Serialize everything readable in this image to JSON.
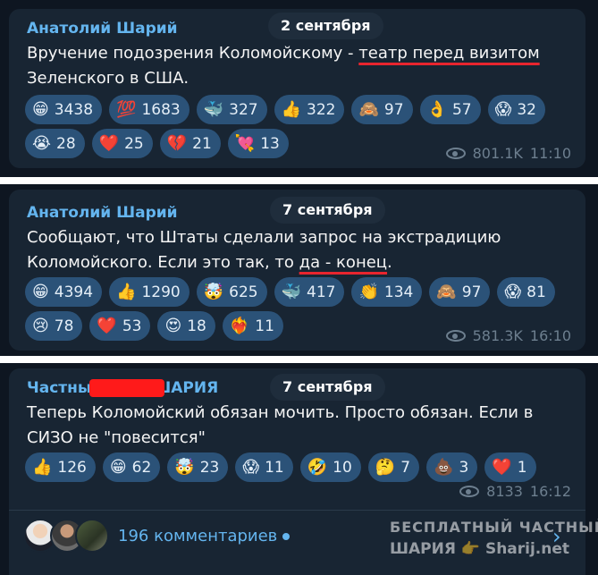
{
  "messages": [
    {
      "author": "Анатолий Шарий",
      "date": "2 сентября",
      "text_lines": [
        "Вручение подозрения Коломойскому - ",
        "театр перед визитом",
        "Зеленского в США."
      ],
      "reactions_row1": [
        {
          "emoji": "😁",
          "icon": "grin-icon",
          "count": "3438"
        },
        {
          "emoji": "💯",
          "icon": "hundred-icon",
          "count": "1683"
        },
        {
          "emoji": "🐳",
          "icon": "whale-icon",
          "count": "327"
        },
        {
          "emoji": "👍",
          "icon": "thumbs-up-icon",
          "count": "322"
        },
        {
          "emoji": "🙈",
          "icon": "see-no-evil-icon",
          "count": "97"
        },
        {
          "emoji": "👌",
          "icon": "ok-hand-icon",
          "count": "57"
        },
        {
          "emoji": "😱",
          "icon": "scream-icon",
          "count": "32"
        }
      ],
      "reactions_row2": [
        {
          "emoji": "😭",
          "icon": "crying-icon",
          "count": "28"
        },
        {
          "emoji": "❤️",
          "icon": "heart-icon",
          "count": "25"
        },
        {
          "emoji": "💔",
          "icon": "broken-heart-icon",
          "count": "21"
        },
        {
          "emoji": "💘",
          "icon": "heart-arrow-icon",
          "count": "13"
        }
      ],
      "views": "801.1K",
      "time": "11:10"
    },
    {
      "author": "Анатолий Шарий",
      "date": "7 сентября",
      "text_lines": [
        "Сообщают, что Штаты сделали запрос на экстрадицию",
        "Коломойского. Если это так, то ",
        "да - конец",
        "."
      ],
      "reactions_row1": [
        {
          "emoji": "😁",
          "icon": "grin-icon",
          "count": "4394"
        },
        {
          "emoji": "👍",
          "icon": "thumbs-up-icon",
          "count": "1290"
        },
        {
          "emoji": "🤯",
          "icon": "mind-blown-icon",
          "count": "625"
        },
        {
          "emoji": "🐳",
          "icon": "whale-icon",
          "count": "417"
        },
        {
          "emoji": "👏",
          "icon": "clap-icon",
          "count": "134"
        },
        {
          "emoji": "🙈",
          "icon": "see-no-evil-icon",
          "count": "97"
        },
        {
          "emoji": "😱",
          "icon": "scream-icon",
          "count": "81"
        }
      ],
      "reactions_row2": [
        {
          "emoji": "😢",
          "icon": "sad-icon",
          "count": "78"
        },
        {
          "emoji": "❤️",
          "icon": "heart-icon",
          "count": "53"
        },
        {
          "emoji": "😍",
          "icon": "heart-eyes-icon",
          "count": "18"
        },
        {
          "emoji": "❤️‍🔥",
          "icon": "heart-fire-icon",
          "count": "11"
        }
      ],
      "views": "581.3K",
      "time": "16:10"
    },
    {
      "author_start": "Частны",
      "author_end": "ШАРИЯ",
      "date": "7 сентября",
      "text_lines": [
        "Теперь Коломойский обязан мочить. Просто обязан. Если в",
        "СИЗО не \"повесится\""
      ],
      "reactions_row1": [
        {
          "emoji": "👍",
          "icon": "thumbs-up-icon",
          "count": "126"
        },
        {
          "emoji": "😁",
          "icon": "grin-icon",
          "count": "62"
        },
        {
          "emoji": "🤯",
          "icon": "mind-blown-icon",
          "count": "23"
        },
        {
          "emoji": "😱",
          "icon": "scream-icon",
          "count": "11"
        },
        {
          "emoji": "🤣",
          "icon": "rofl-icon",
          "count": "10"
        },
        {
          "emoji": "🤔",
          "icon": "thinking-icon",
          "count": "7"
        },
        {
          "emoji": "💩",
          "icon": "poo-icon",
          "count": "3"
        },
        {
          "emoji": "❤️",
          "icon": "heart-icon",
          "count": "1"
        }
      ],
      "views": "8133",
      "time": "16:12",
      "comments": "196 комментариев"
    }
  ],
  "watermark": {
    "line1": "БЕСПЛАТНЫЙ ЧАСТНЫЙ",
    "line2a": "ШАРИЯ",
    "line2b": "Sharij.net"
  },
  "colors": {
    "background": "#0e1621",
    "bubble": "#182533",
    "accent": "#64b5ef",
    "reaction": "#2b5278",
    "underline": "#e8252e",
    "redaction": "#ff1a1a"
  }
}
